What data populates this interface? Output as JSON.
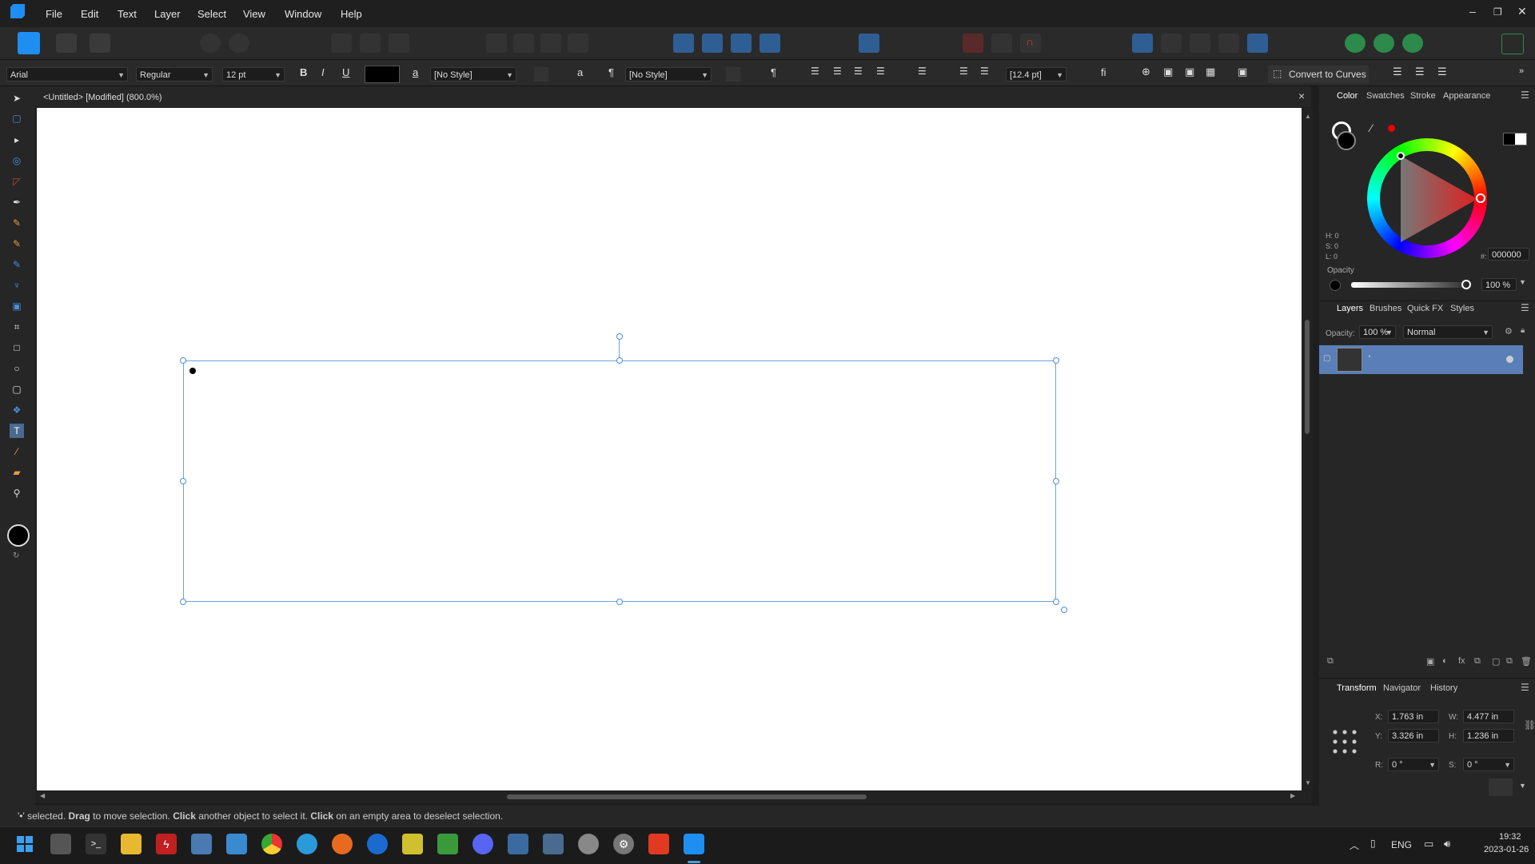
{
  "menu": [
    "File",
    "Edit",
    "Text",
    "Layer",
    "Select",
    "View",
    "Window",
    "Help"
  ],
  "context": {
    "font_family": "Arial",
    "font_style": "Regular",
    "font_size": "12 pt",
    "bold": "B",
    "italic": "I",
    "underline": "U",
    "char_style_glyph": "a",
    "char_style": "[No Style]",
    "para_glyph": "¶",
    "para_style": "[No Style]",
    "char_glyph2": "a",
    "pilcrow2": "¶",
    "leading": "[12.4 pt]",
    "ligature": "fi",
    "convert_label": "Convert to Curves"
  },
  "document": {
    "tab_title": "<Untitled> [Modified] (800.0%)",
    "close": "×"
  },
  "color_panel": {
    "tabs": [
      "Color",
      "Swatches",
      "Stroke",
      "Appearance"
    ],
    "h": "H: 0",
    "s": "S: 0",
    "l": "L: 0",
    "hex_label": "#:",
    "hex": "000000",
    "opacity_label": "Opacity",
    "opacity": "100 %"
  },
  "layers_panel": {
    "tabs": [
      "Layers",
      "Brushes",
      "Quick FX",
      "Styles"
    ],
    "opacity_label": "Opacity:",
    "opacity": "100 %",
    "blend": "Normal",
    "layer_name": "'"
  },
  "transform_panel": {
    "tabs": [
      "Transform",
      "Navigator",
      "History"
    ],
    "x_label": "X:",
    "x": "1.763 in",
    "y_label": "Y:",
    "y": "3.326 in",
    "w_label": "W:",
    "w": "4.477 in",
    "h_label": "H:",
    "h": "1.236 in",
    "r_label": "R:",
    "r": "0 °",
    "s_label": "S:",
    "s": "0 °"
  },
  "status": {
    "p1": "'•' selected. ",
    "drag": "Drag",
    "p2": " to move selection. ",
    "click": "Click",
    "p3": " another object to select it. ",
    "click2": "Click",
    "p4": " on an empty area to deselect selection."
  },
  "taskbar": {
    "lang": "ENG",
    "time": "19:32",
    "date": "2023-01-26"
  },
  "colors": {
    "accent": "#4a8fdc",
    "selection": "#5a7fb8"
  }
}
